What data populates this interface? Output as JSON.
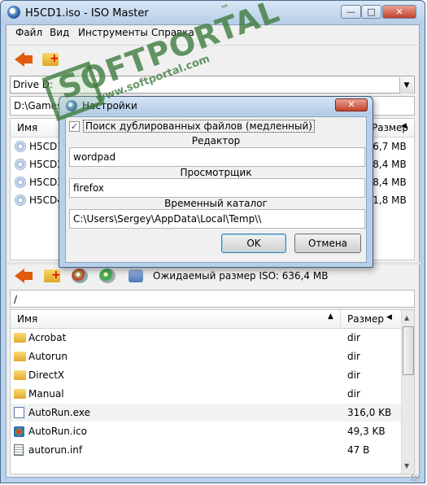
{
  "window": {
    "title": "H5CD1.iso - ISO Master",
    "minimize_icon": "minimize-icon",
    "maximize_icon": "maximize-icon",
    "close_icon": "close-icon",
    "min_glyph": "—",
    "max_glyph": "□",
    "close_glyph": "✕"
  },
  "menubar": {
    "file": "Файл",
    "view": "Вид",
    "tools": "Инструменты",
    "help": "Справка"
  },
  "top_pane": {
    "combo_value": "Drive D:",
    "path_value": "D:\\Games\\",
    "col_name": "Имя",
    "col_size": "Размер",
    "rows": [
      {
        "name": "H5CD1",
        "size": "636,7 MB"
      },
      {
        "name": "H5CD2",
        "size": "698,4 MB"
      },
      {
        "name": "H5CD3",
        "size": "698,4 MB"
      },
      {
        "name": "H5CD4",
        "size": "541,8 MB"
      }
    ]
  },
  "watermark": {
    "big": "SOFTPORTAL",
    "small": "www.softportal.com",
    "tm": "™"
  },
  "dialog": {
    "title": "Настройки",
    "duplicates_label": "Поиск дублированных файлов (медленный)",
    "duplicates_checked": true,
    "editor_label": "Редактор",
    "editor_value": "wordpad",
    "viewer_label": "Просмотрщик",
    "viewer_value": "firefox",
    "tempdir_label": "Временный каталог",
    "tempdir_value": "C:\\Users\\Sergey\\AppData\\Local\\Temp\\\\",
    "ok_label": "OK",
    "cancel_label": "Отмена",
    "close_glyph": "✕"
  },
  "bottom_pane": {
    "iso_size_label": "Ожидаемый размер ISO: 636,4 MB",
    "path_value": "/",
    "col_name": "Имя",
    "col_size": "Размер",
    "rows": [
      {
        "name": "Acrobat",
        "size": "dir",
        "icon": "folder-icon"
      },
      {
        "name": "Autorun",
        "size": "dir",
        "icon": "folder-icon"
      },
      {
        "name": "DirectX",
        "size": "dir",
        "icon": "folder-icon"
      },
      {
        "name": "Manual",
        "size": "dir",
        "icon": "folder-icon"
      },
      {
        "name": "AutoRun.exe",
        "size": "316,0 KB",
        "icon": "exe-icon"
      },
      {
        "name": "AutoRun.ico",
        "size": "49,3 KB",
        "icon": "ico-icon"
      },
      {
        "name": "autorun.inf",
        "size": "47 B",
        "icon": "inf-icon"
      }
    ]
  },
  "colors": {
    "accent_arrow": "#e25a0c",
    "watermark_green": "#3b7a3b"
  }
}
